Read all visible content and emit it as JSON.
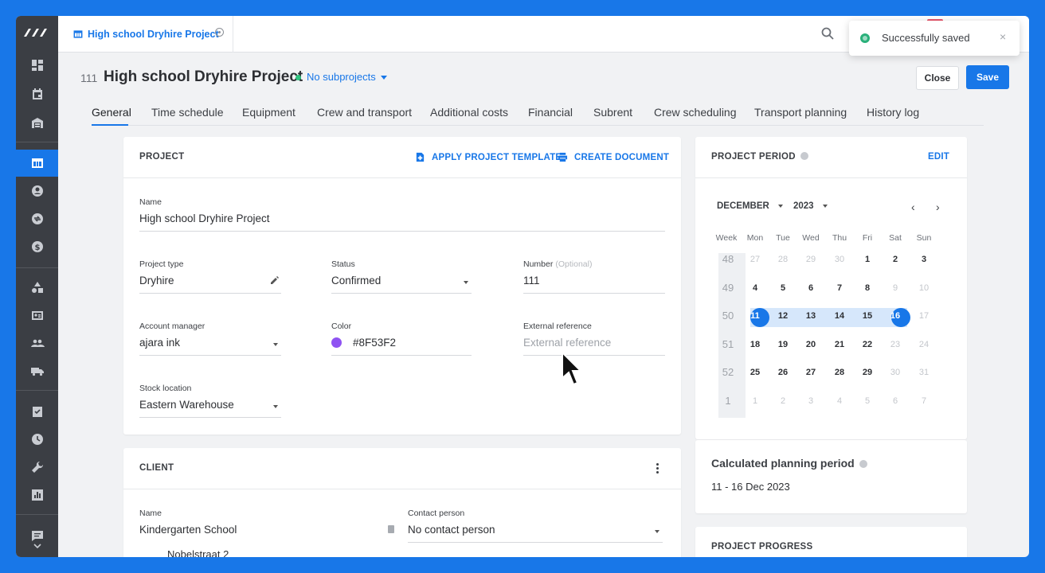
{
  "window": {
    "title": "High school Dryhire Project"
  },
  "toast": {
    "message": "Successfully saved"
  },
  "header": {
    "number": "111",
    "title": "High school Dryhire Project",
    "subprojects": "No subprojects",
    "close_label": "Close",
    "save_label": "Save"
  },
  "tabs": [
    "General",
    "Time schedule",
    "Equipment",
    "Crew and transport",
    "Additional costs",
    "Financial",
    "Subrent",
    "Crew scheduling",
    "Transport planning",
    "History log"
  ],
  "project_card": {
    "title": "PROJECT",
    "apply_template": "APPLY PROJECT TEMPLATE",
    "create_document": "CREATE DOCUMENT",
    "name_label": "Name",
    "name_value": "High school Dryhire Project",
    "type_label": "Project type",
    "type_value": "Dryhire",
    "status_label": "Status",
    "status_value": "Confirmed",
    "number_label": "Number",
    "number_optional": "(Optional)",
    "number_value": "111",
    "manager_label": "Account manager",
    "manager_value": "ajara ink",
    "color_label": "Color",
    "color_value": "#8F53F2",
    "extref_label": "External reference",
    "extref_placeholder": "External reference",
    "stock_label": "Stock location",
    "stock_value": "Eastern Warehouse"
  },
  "client_card": {
    "title": "CLIENT",
    "name_label": "Name",
    "name_value": "Kindergarten School",
    "contact_label": "Contact person",
    "contact_value": "No contact person",
    "address": "Nobelstraat 2"
  },
  "period_card": {
    "title": "PROJECT PERIOD",
    "edit": "EDIT",
    "month": "DECEMBER",
    "year": "2023",
    "weekdays": [
      "Week",
      "Mon",
      "Tue",
      "Wed",
      "Thu",
      "Fri",
      "Sat",
      "Sun"
    ],
    "weeks": [
      {
        "wk": "48",
        "days": [
          "27",
          "28",
          "29",
          "30",
          "1",
          "2",
          "3"
        ]
      },
      {
        "wk": "49",
        "days": [
          "4",
          "5",
          "6",
          "7",
          "8",
          "9",
          "10"
        ]
      },
      {
        "wk": "50",
        "days": [
          "11",
          "12",
          "13",
          "14",
          "15",
          "16",
          "17"
        ]
      },
      {
        "wk": "51",
        "days": [
          "18",
          "19",
          "20",
          "21",
          "22",
          "23",
          "24"
        ]
      },
      {
        "wk": "52",
        "days": [
          "25",
          "26",
          "27",
          "28",
          "29",
          "30",
          "31"
        ]
      },
      {
        "wk": "1",
        "days": [
          "1",
          "2",
          "3",
          "4",
          "5",
          "6",
          "7"
        ]
      }
    ],
    "selected_start": "11",
    "selected_end": "16"
  },
  "planning_card": {
    "title": "Calculated planning period",
    "value": "11 - 16 Dec 2023"
  },
  "progress_card": {
    "title": "PROJECT PROGRESS"
  },
  "colors": {
    "accent": "#1877e8",
    "sidebar": "#3b3e44",
    "project_color": "#8F53F2",
    "status_green": "#2ec27e"
  }
}
